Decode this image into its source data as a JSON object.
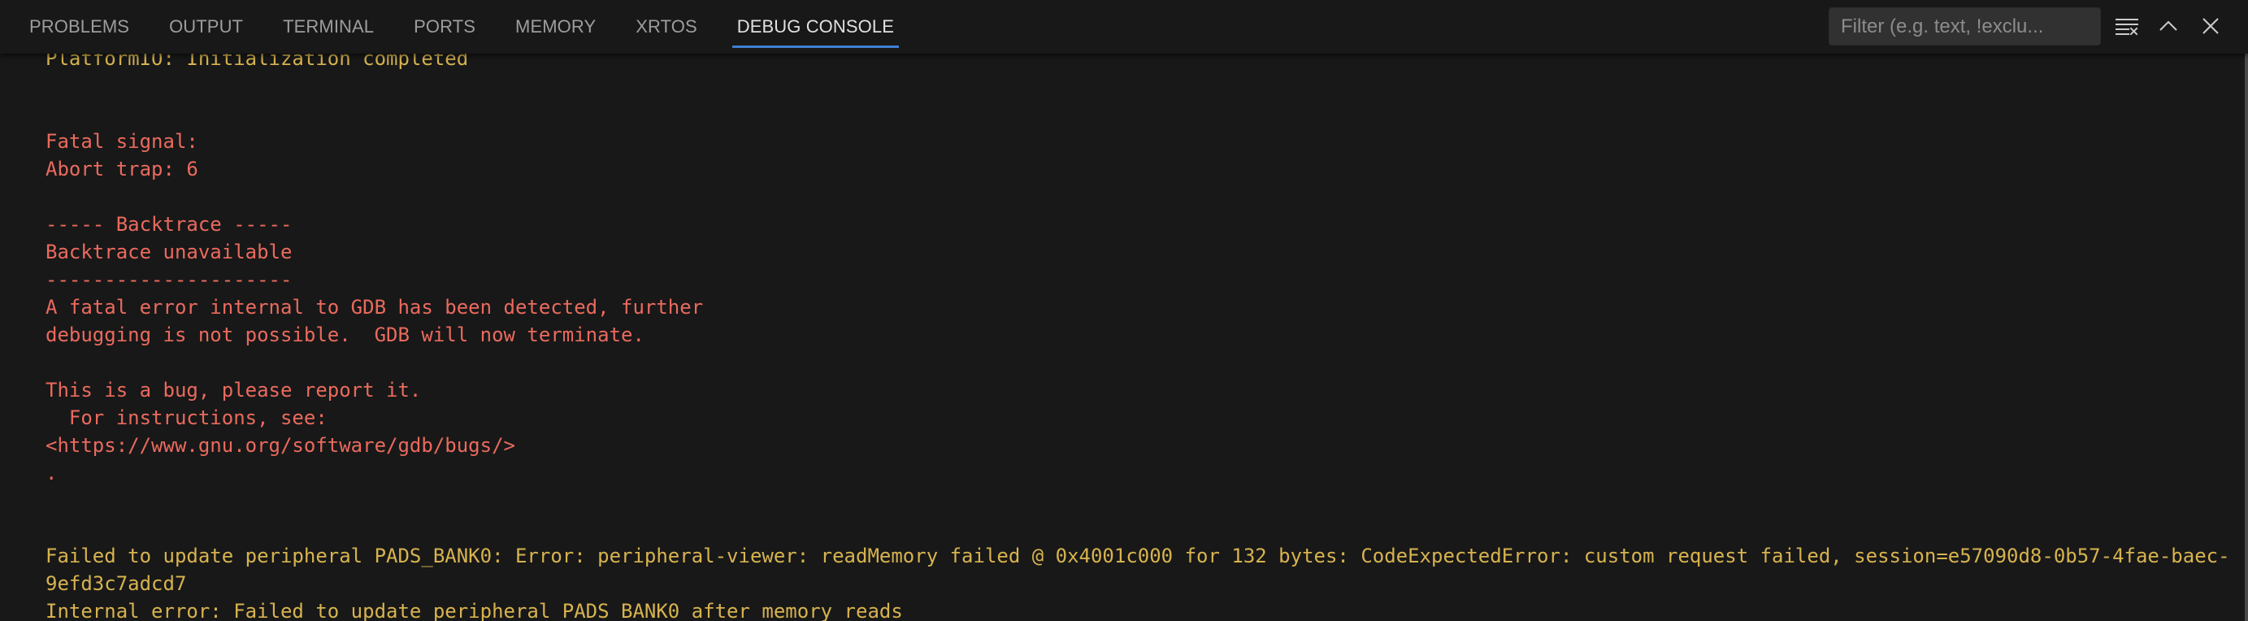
{
  "panel": {
    "tabs": [
      {
        "label": "PROBLEMS",
        "active": false
      },
      {
        "label": "OUTPUT",
        "active": false
      },
      {
        "label": "TERMINAL",
        "active": false
      },
      {
        "label": "PORTS",
        "active": false
      },
      {
        "label": "MEMORY",
        "active": false
      },
      {
        "label": "XRTOS",
        "active": false
      },
      {
        "label": "DEBUG CONSOLE",
        "active": true
      }
    ],
    "filter": {
      "placeholder": "Filter (e.g. text, !exclu...",
      "value": ""
    },
    "actions": [
      {
        "name": "clear-console",
        "icon": "clear-all-icon"
      },
      {
        "name": "maximize-panel",
        "icon": "chevron-up-icon"
      },
      {
        "name": "close-panel",
        "icon": "close-icon"
      }
    ],
    "colors": {
      "accent": "#3f7fd1",
      "warning_text": "#d7b34f",
      "error_text": "#ea6a5e",
      "background": "#181818"
    }
  },
  "console": {
    "lines": [
      {
        "text": "PlatformIO: Initialization completed",
        "level": "warn"
      },
      {
        "text": "",
        "level": "warn"
      },
      {
        "text": "",
        "level": "warn"
      },
      {
        "text": "Fatal signal:",
        "level": "err"
      },
      {
        "text": "Abort trap: 6",
        "level": "err"
      },
      {
        "text": "",
        "level": "err"
      },
      {
        "text": "----- Backtrace -----",
        "level": "err"
      },
      {
        "text": "Backtrace unavailable",
        "level": "err"
      },
      {
        "text": "---------------------",
        "level": "err"
      },
      {
        "text": "A fatal error internal to GDB has been detected, further",
        "level": "err"
      },
      {
        "text": "debugging is not possible.  GDB will now terminate.",
        "level": "err"
      },
      {
        "text": "",
        "level": "err"
      },
      {
        "text": "This is a bug, please report it.",
        "level": "err"
      },
      {
        "text": "  For instructions, see:",
        "level": "err"
      },
      {
        "text": "<https://www.gnu.org/software/gdb/bugs/>",
        "level": "err"
      },
      {
        "text": ".",
        "level": "err"
      },
      {
        "text": "",
        "level": "err"
      },
      {
        "text": "",
        "level": "warn"
      },
      {
        "text": "Failed to update peripheral PADS_BANK0: Error: peripheral-viewer: readMemory failed @ 0x4001c000 for 132 bytes: CodeExpectedError: custom request failed, session=e57090d8-0b57-4fae-baec-",
        "level": "warn"
      },
      {
        "text": "9efd3c7adcd7",
        "level": "warn"
      },
      {
        "text": "Internal error: Failed to update peripheral PADS_BANK0 after memory reads",
        "level": "warn"
      }
    ]
  }
}
